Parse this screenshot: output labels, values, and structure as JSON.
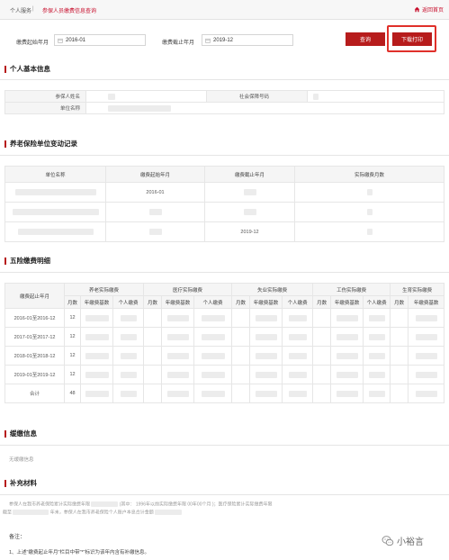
{
  "breadcrumb": {
    "item1": "个人服务",
    "separator": "|",
    "item2": "参保人员缴费信息查询",
    "home": "返回首页"
  },
  "filter": {
    "start_label": "缴费起始年月",
    "start_value": "2016-01",
    "end_label": "缴费截止年月",
    "end_value": "2019-12",
    "query_button": "查询",
    "download_button": "下载打印"
  },
  "basic_info": {
    "title": "个人基本信息",
    "name_label": "参保人姓名",
    "ssn_label": "社会保障号码",
    "unit_label": "单位名称"
  },
  "pension_changes": {
    "title": "养老保险单位变动记录",
    "headers": [
      "单位名称",
      "缴费起始年月",
      "缴费截止年月",
      "实际缴费月数"
    ],
    "rows": [
      {
        "start": "2016-01",
        "end": ""
      },
      {
        "start": "",
        "end": ""
      },
      {
        "start": "",
        "end": "2019-12"
      }
    ]
  },
  "five_insurance": {
    "title": "五险缴费明细",
    "period_header": "缴费起止年月",
    "groups": [
      "养老实际缴费",
      "医疗实际缴费",
      "失业实际缴费",
      "工伤实际缴费",
      "生育实际缴费"
    ],
    "sub": {
      "months": "月数",
      "base": "年缴费基数",
      "personal": "个人缴费"
    },
    "rows": [
      {
        "period": "2016-01至2016-12",
        "months": "12"
      },
      {
        "period": "2017-01至2017-12",
        "months": "12"
      },
      {
        "period": "2018-01至2018-12",
        "months": "12"
      },
      {
        "period": "2019-01至2019-12",
        "months": "12"
      },
      {
        "period": "合计",
        "months": "48"
      }
    ]
  },
  "arrears": {
    "title": "缓缴信息",
    "empty": "无缓缴信息"
  },
  "supplement": {
    "title": "补充材料",
    "line1a": "参保人在我市养老保险累计实际缴费年限",
    "line1b": "(其中：",
    "line1c": "1996年以前实际缴费年限",
    "line1d": "00年00个月",
    "line1e": ")；医疗保险累计实际缴费年限",
    "line2a": "截至",
    "line2b": "年末，参保人在我市养老保险个人账户本息合计金额",
    "note_title": "备注：",
    "note1": "1、上述\"缴费起止年月\"栏目中带\"*\"标识为该年内含有补缴信息。"
  },
  "watermark": {
    "text": "小裕言"
  }
}
